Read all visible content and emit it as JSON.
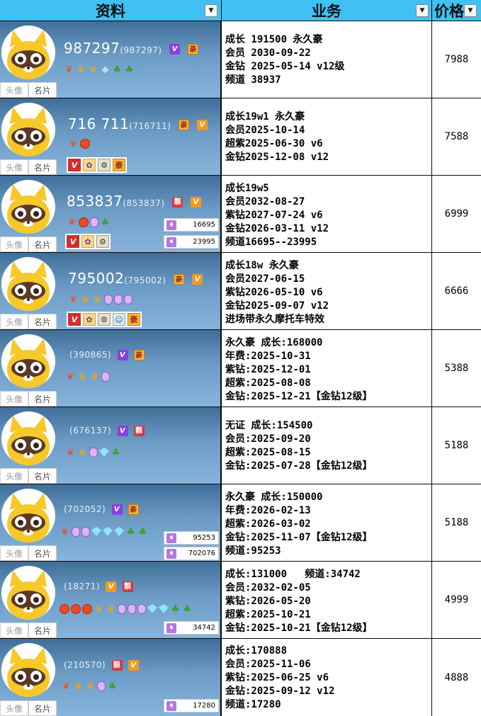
{
  "header": {
    "col1": "资料",
    "col2": "业务",
    "col3": "价格",
    "filter_icon": "dropdown-filter-icon"
  },
  "tabs": {
    "avatar": "头像",
    "card": "名片"
  },
  "rows": [
    {
      "main": "987297",
      "paren": "(987297)",
      "lines": [
        "成长 191500 永久豪",
        "会员 2030-09-22",
        "金钻 2025-05-14 v12级",
        "频道 38937"
      ],
      "price": "7988",
      "channels": []
    },
    {
      "main": "716 711",
      "paren": "(716711)",
      "lines": [
        "成长19w1 永久豪",
        "会员2025-10-14",
        "超紫2025-06-30 v6",
        "金钻2025-12-08 v12"
      ],
      "price": "7588",
      "channels": []
    },
    {
      "main": "853837",
      "paren": "(853837)",
      "lines": [
        "成长19w5",
        "会员2032-08-27",
        "紫钻2027-07-24 v6",
        "金钻2026-03-11 v12",
        "频道16695--23995"
      ],
      "price": "6999",
      "channels": [
        "16695",
        "23995"
      ]
    },
    {
      "main": "795002",
      "paren": "(795002)",
      "lines": [
        "成长18w 永久豪",
        "会员2027-06-15",
        "紫钻2026-05-10 v6",
        "金钻2025-09-07 v12",
        "进场带永久摩托车特效"
      ],
      "price": "6666",
      "channels": []
    },
    {
      "main": "",
      "paren": "(390865)",
      "lines": [
        "永久豪 成长:168000",
        "年费:2025-10-31",
        "紫钻:2025-12-01",
        "超紫:2025-08-08",
        "金钻:2025-12-21【金钻12级】"
      ],
      "price": "5388",
      "channels": []
    },
    {
      "main": "",
      "paren": "(676137)",
      "lines": [
        "无证 成长:154500",
        "会员:2025-09-20",
        "超紫:2025-08-15",
        "金钻:2025-07-28【金钻12级】"
      ],
      "price": "5188",
      "channels": []
    },
    {
      "main": "",
      "paren": "(702052)",
      "lines": [
        "永久豪 成长:150000",
        "年费:2026-02-13",
        "超紫:2026-03-02",
        "金钻:2025-11-07【金钻12级】",
        "频道:95253"
      ],
      "price": "5188",
      "channels": [
        "95253",
        "702076"
      ]
    },
    {
      "main": "",
      "paren": "(18271)",
      "lines": [
        "成长:131000   频道:34742",
        "会员:2032-02-05",
        "紫钻:2026-05-20",
        "超紫:2025-10-21",
        "金钻:2025-10-21【金钻12级】"
      ],
      "price": "4999",
      "channels": [
        "34742"
      ]
    },
    {
      "main": "",
      "paren": "(210570)",
      "lines": [
        "成长:170888",
        "会员:2025-11-06",
        "紫钻:2025-06-25 v6",
        "金钻:2025-09-12 v12",
        "频道:17280"
      ],
      "price": "4888",
      "channels": [
        "17280"
      ]
    }
  ],
  "badges": {
    "v": "V",
    "hao": "豪",
    "liang": "靓"
  }
}
